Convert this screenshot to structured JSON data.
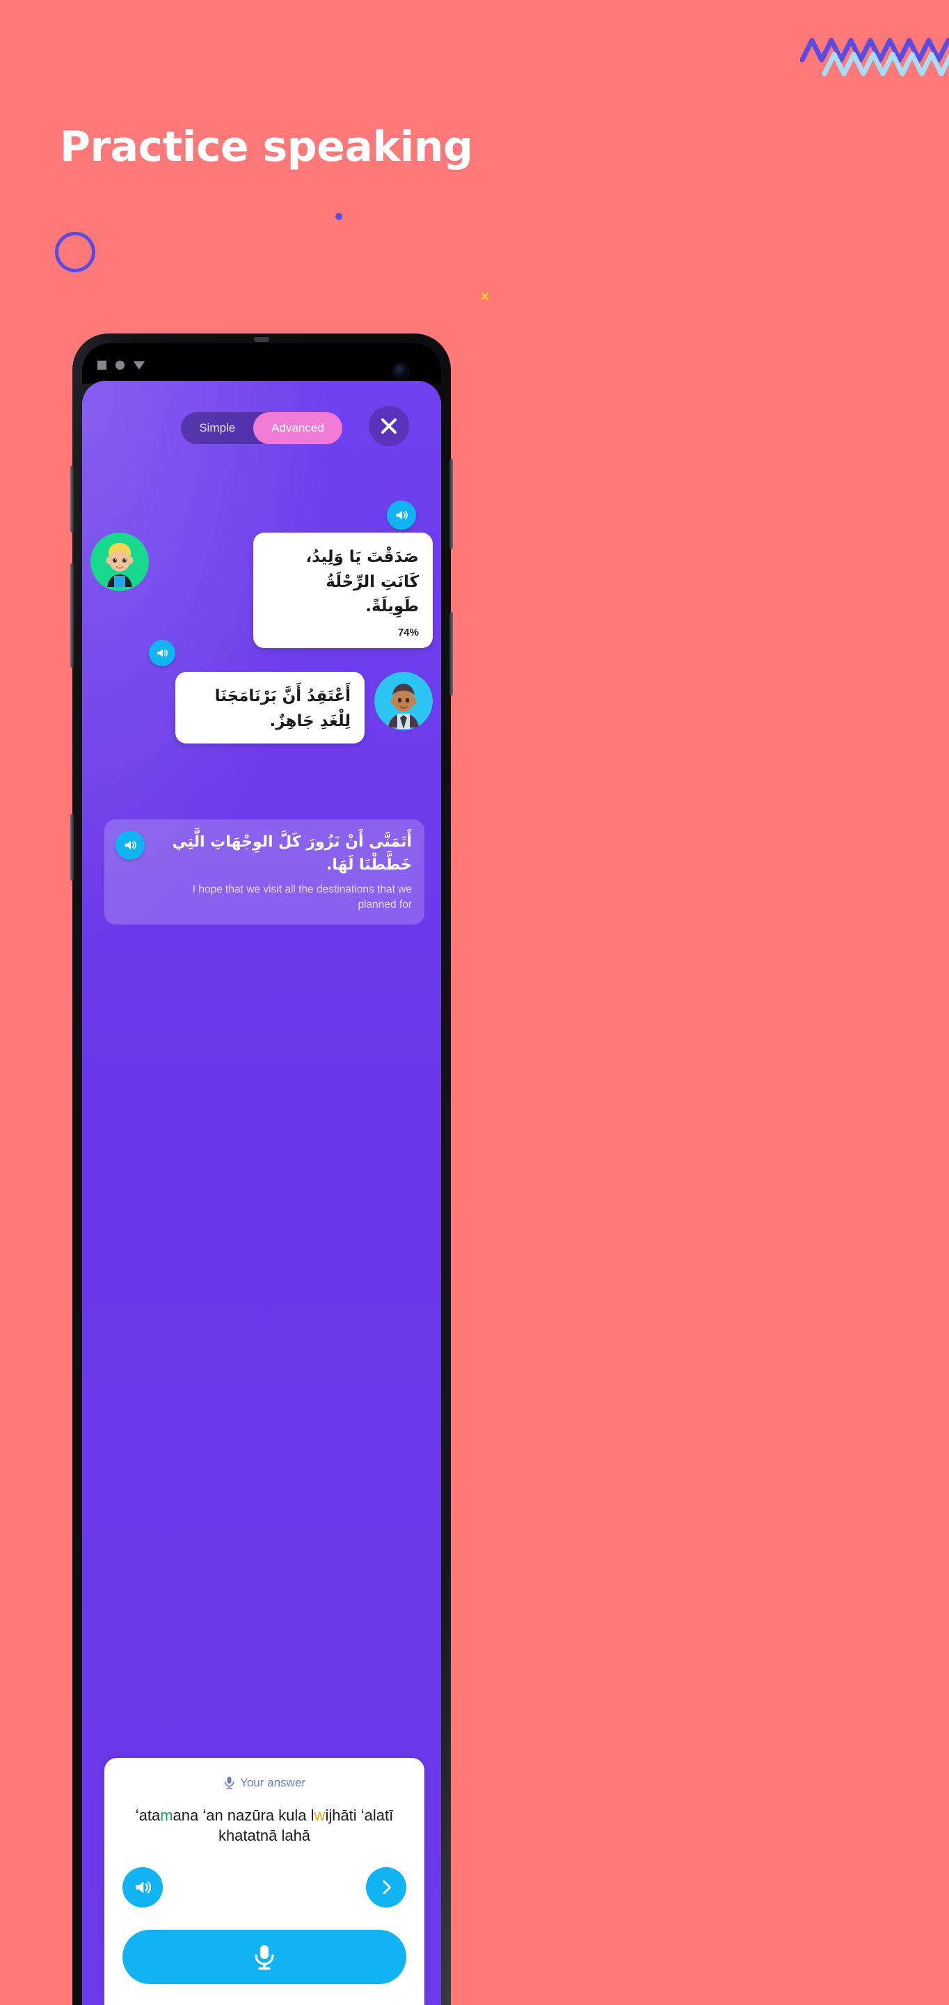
{
  "page": {
    "title": "Practice speaking",
    "background_color": "#FD7878",
    "accent_purple": "#5B4BE0",
    "accent_yellow": "#FFD21E",
    "accent_blue": "#A8DCF5"
  },
  "decorations": {
    "zigzag_purple": "zigzag-line",
    "zigzag_blue": "zigzag-line",
    "circle_outline": "circle-outline",
    "dot": "small-dot",
    "cross": "×"
  },
  "phone": {
    "status_icons": [
      "square",
      "circle",
      "triangle-down"
    ],
    "screen_background": "#6A3BE8"
  },
  "app": {
    "tabs": [
      {
        "label": "Simple",
        "active": false
      },
      {
        "label": "Advanced",
        "active": true
      }
    ],
    "close_label": "×",
    "messages": [
      {
        "speaker": "child",
        "avatar_bg": "#18D88E",
        "arabic": "صَدَقْتَ يَا وَلِيدُ، كَانَتِ الرِّحْلَةُ طَوِيلَةً.",
        "score": "74%",
        "audio_icon": "speaker-icon"
      },
      {
        "speaker": "man",
        "avatar_bg": "#2BC4F3",
        "arabic": "أَعْتَقِدُ أَنَّ بَرْنَامَجَنَا لِلْغَدِ جَاهِزٌ.",
        "audio_icon": "speaker-icon"
      }
    ],
    "prompt": {
      "arabic": "أَتَمَنَّى أَنْ نَزُورَ كَلَّ الوِجْهَاتِ الَّتِي خَطَّطْنَا لَهَا.",
      "english": "I hope that we visit all the destinations that we planned for",
      "audio_icon": "speaker-icon"
    },
    "answer": {
      "label": "Your answer",
      "mic_icon": "microphone-icon",
      "transliteration_line1_a": "ʻata",
      "transliteration_line1_g": "m",
      "transliteration_line1_b": "ana ʻan nazūra kula l",
      "transliteration_line1_o": "w",
      "transliteration_line1_c": "ijhāti ʻalatī",
      "transliteration_line2": "khatatnā lahā",
      "play_icon": "speaker-icon",
      "next_icon": "chevron-right-icon",
      "record_icon": "microphone-icon"
    }
  }
}
